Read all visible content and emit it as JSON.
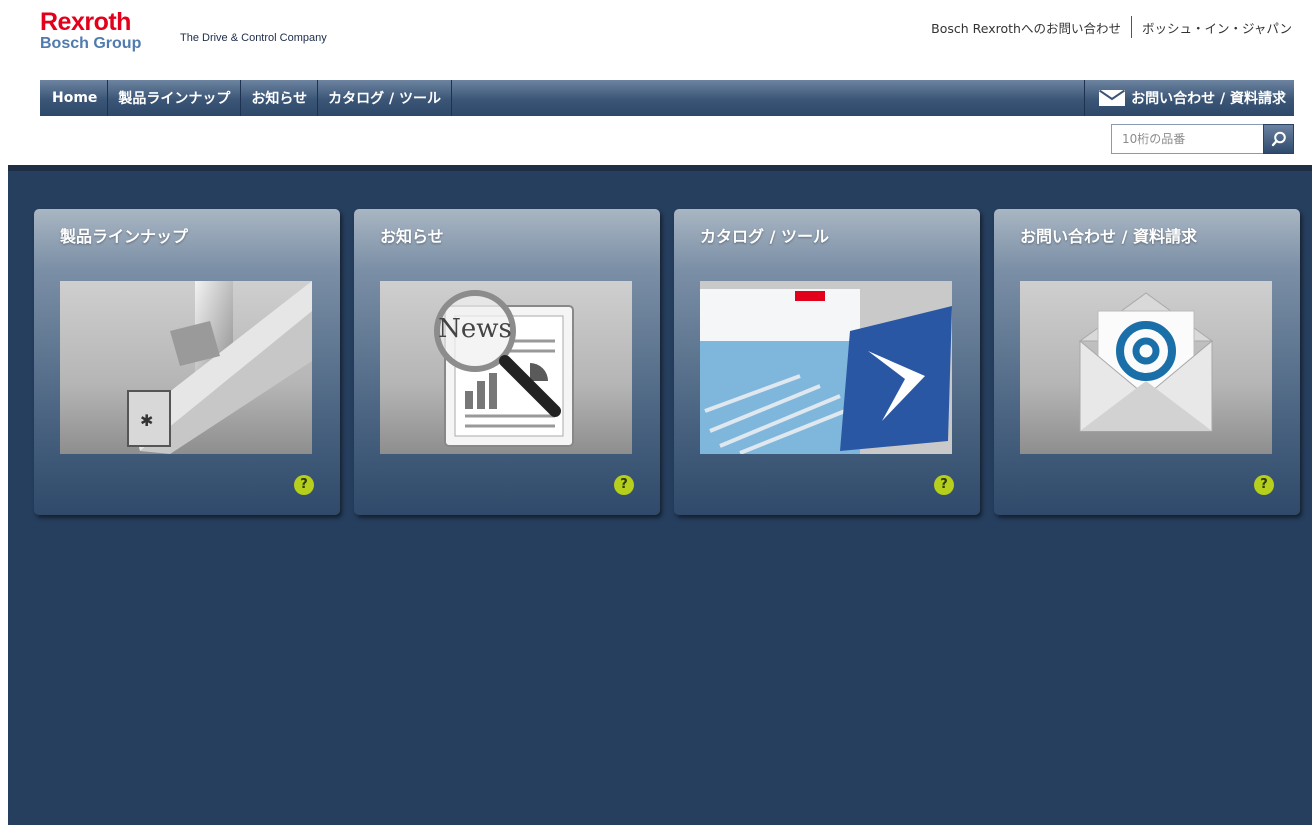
{
  "brand": {
    "name": "Rexroth",
    "group": "Bosch Group",
    "tagline": "The Drive & Control Company"
  },
  "toplinks": {
    "contact": "Bosch Rexrothへのお問い合わせ",
    "japan": "ボッシュ・イン・ジャパン"
  },
  "nav": {
    "home": "Home",
    "products": "製品ラインナップ",
    "news": "お知らせ",
    "catalog": "カタログ / ツール",
    "contact": "お問い合わせ / 資料請求"
  },
  "search": {
    "placeholder": "10桁の品番"
  },
  "tiles": [
    {
      "title": "製品ラインナップ",
      "icon": "aluminum-profile-image"
    },
    {
      "title": "お知らせ",
      "icon": "news-magnifier-image",
      "image_text": "News"
    },
    {
      "title": "カタログ / ツール",
      "icon": "catalog-image"
    },
    {
      "title": "お問い合わせ / 資料請求",
      "icon": "envelope-at-image"
    }
  ],
  "colors": {
    "brand_red": "#e2001a",
    "brand_blue": "#4f7bae",
    "nav_bg": "#3b5576",
    "main_bg": "#263f5e",
    "help_badge": "#b6cf1d"
  }
}
